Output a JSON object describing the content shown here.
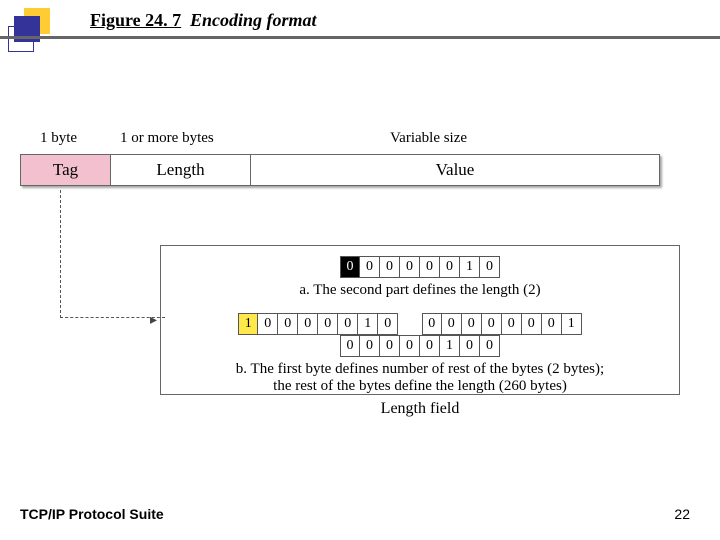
{
  "figure": {
    "label": "Figure 24. 7",
    "title": "Encoding format"
  },
  "columns": {
    "tag_size": "1 byte",
    "length_size": "1 or more bytes",
    "value_size": "Variable size"
  },
  "fields": {
    "tag": "Tag",
    "length": "Length",
    "value": "Value"
  },
  "example_a": {
    "bits": [
      "0",
      "0",
      "0",
      "0",
      "0",
      "0",
      "1",
      "0"
    ],
    "highlight_first": "black",
    "caption": "a. The second part defines the length (2)"
  },
  "example_b": {
    "byte1": [
      "1",
      "0",
      "0",
      "0",
      "0",
      "0",
      "1",
      "0"
    ],
    "byte2": [
      "0",
      "0",
      "0",
      "0",
      "0",
      "0",
      "0",
      "1"
    ],
    "byte3": [
      "0",
      "0",
      "0",
      "0",
      "0",
      "1",
      "0",
      "0"
    ],
    "highlight_first": "yellow",
    "caption": "b. The first byte defines number of rest of the bytes (2 bytes);\nthe rest of the bytes define the length (260 bytes)"
  },
  "length_caption": "Length field",
  "footer": {
    "left": "TCP/IP Protocol Suite",
    "page": "22"
  }
}
